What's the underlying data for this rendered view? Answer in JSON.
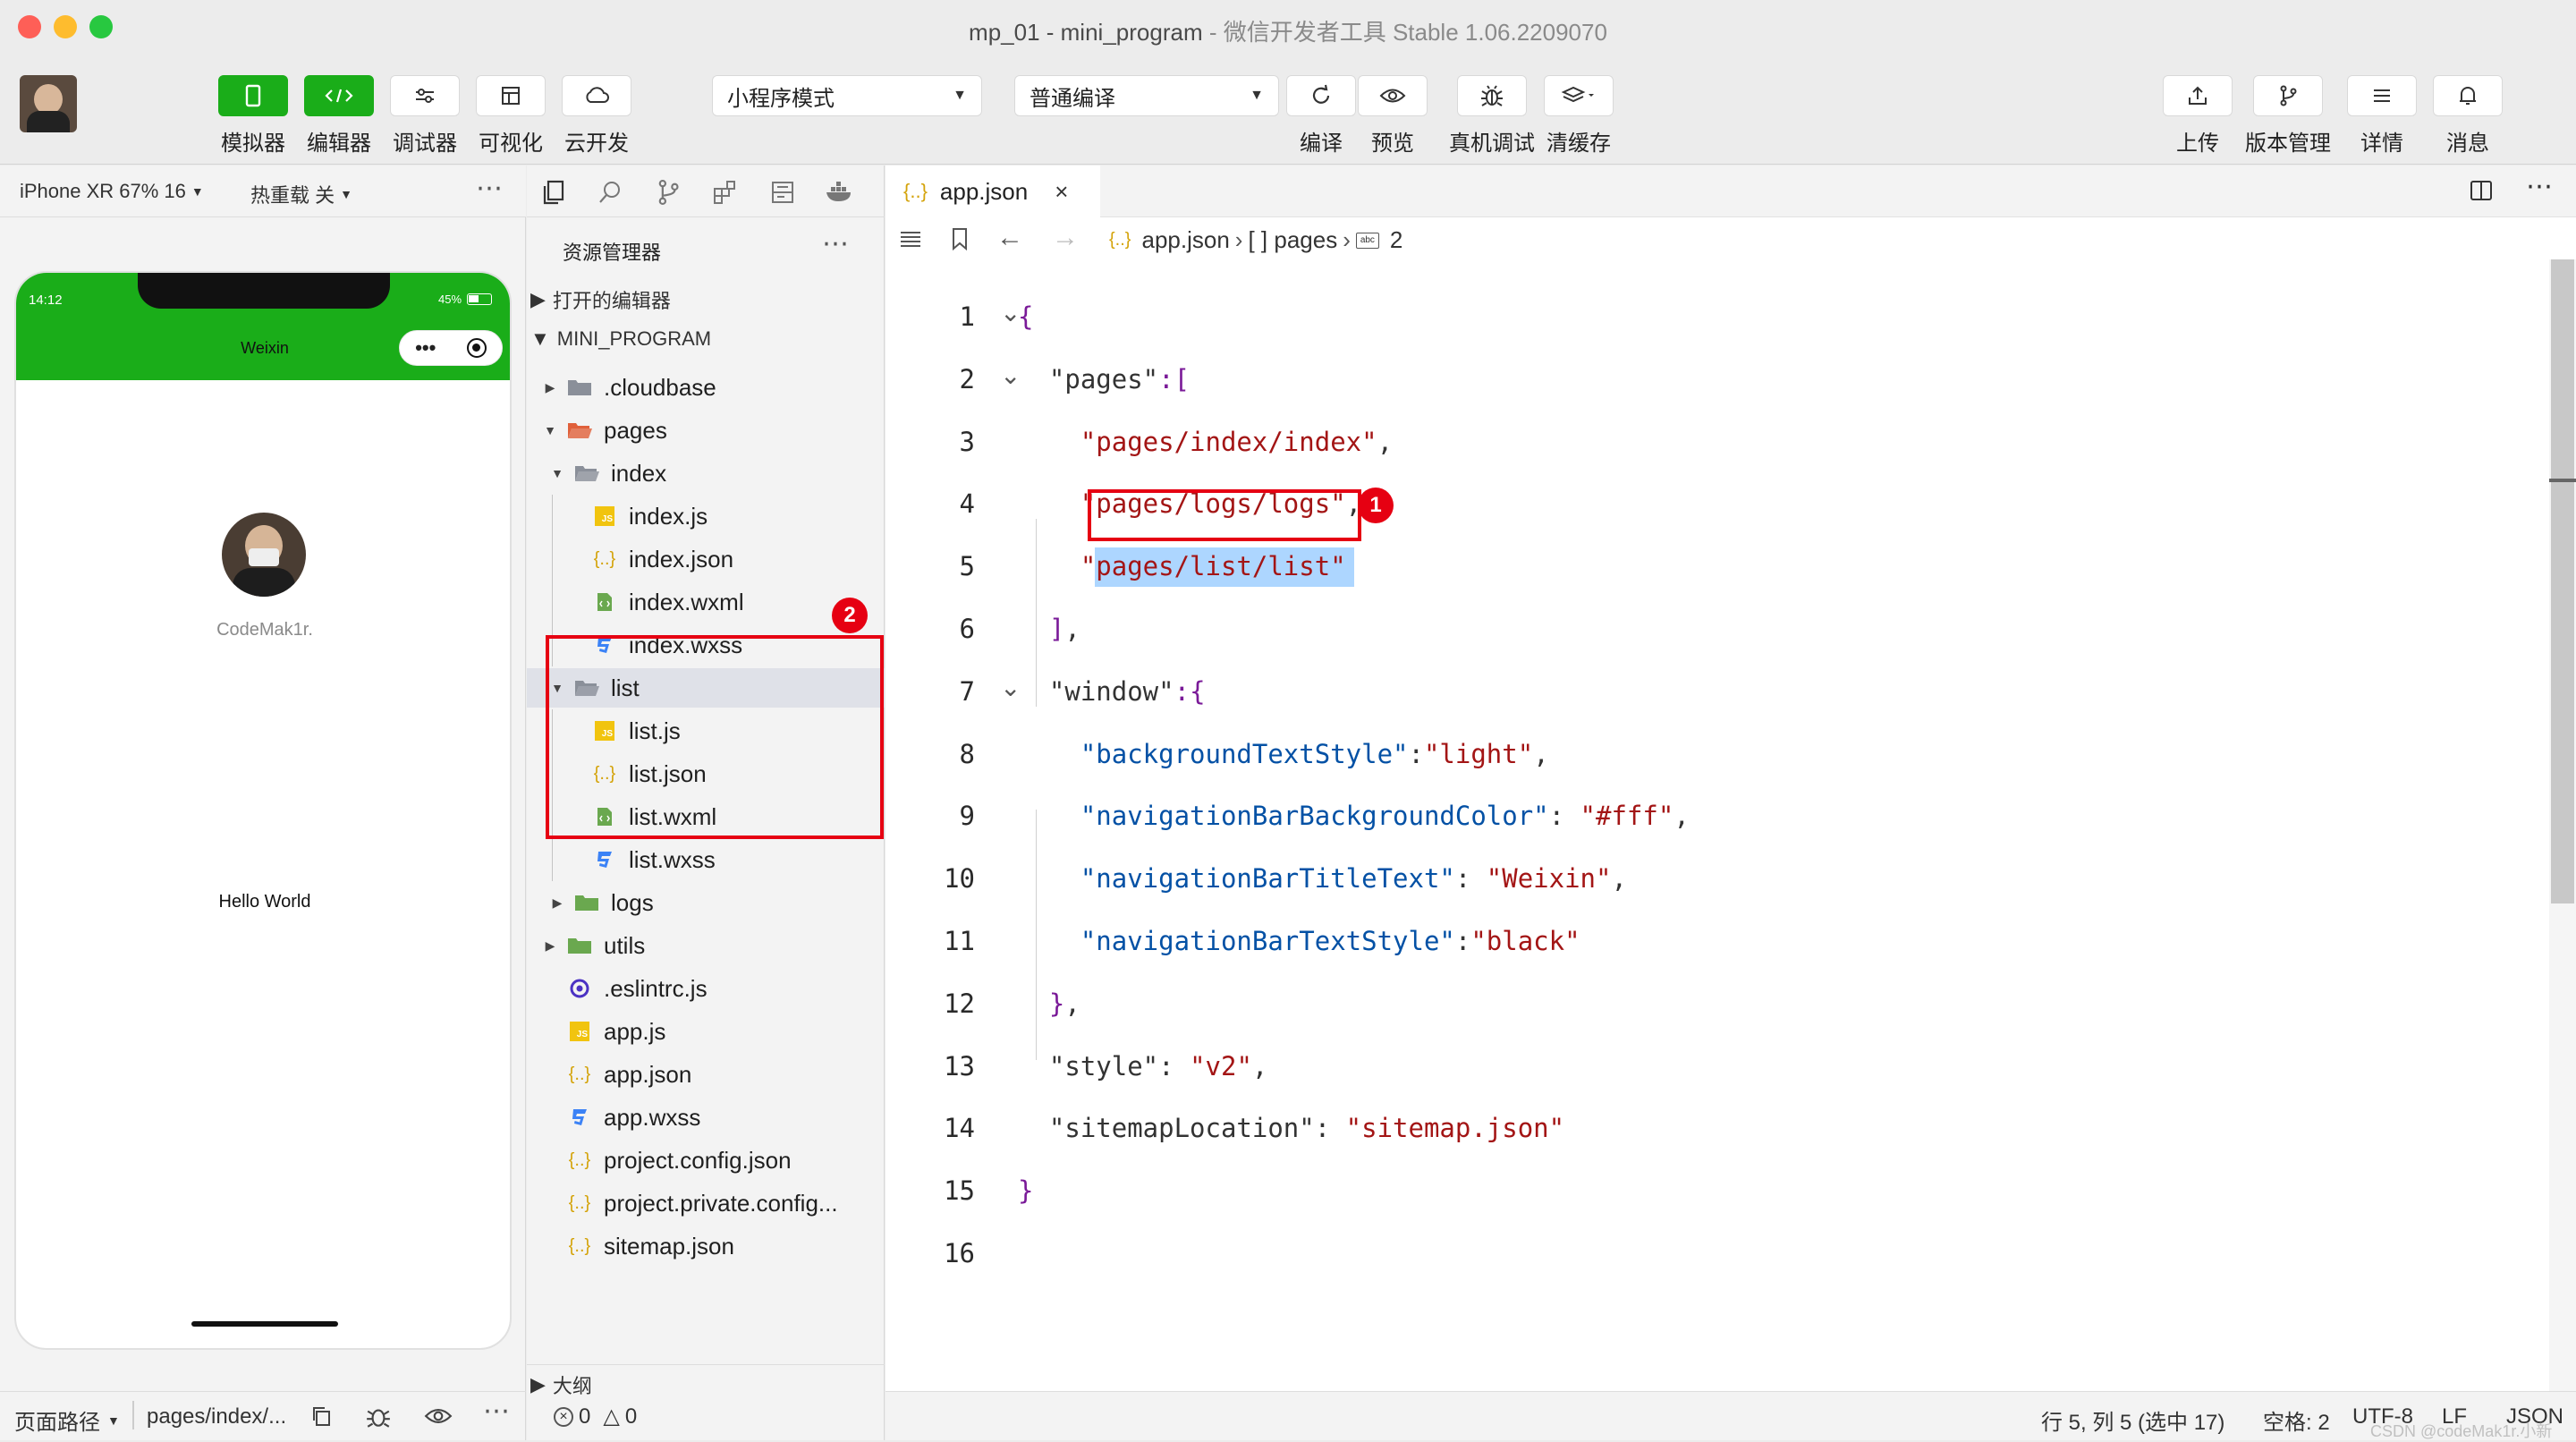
{
  "window": {
    "title_main": "mp_01 - mini_program",
    "title_sub": " - 微信开发者工具 Stable 1.06.2209070"
  },
  "toolbar": {
    "left_buttons": [
      {
        "label": "模拟器",
        "icon": "phone-icon"
      },
      {
        "label": "编辑器",
        "icon": "code-icon"
      },
      {
        "label": "调试器",
        "icon": "sliders-icon"
      },
      {
        "label": "可视化",
        "icon": "layout-icon"
      },
      {
        "label": "云开发",
        "icon": "cloud-icon"
      }
    ],
    "mode_select": "小程序模式",
    "compile_select": "普通编译",
    "mid_buttons": [
      {
        "label": "编译",
        "icon": "refresh-icon"
      },
      {
        "label": "预览",
        "icon": "eye-icon"
      },
      {
        "label": "真机调试",
        "icon": "bug-icon"
      },
      {
        "label": "清缓存",
        "icon": "layers-icon"
      }
    ],
    "right_buttons": [
      {
        "label": "上传",
        "icon": "upload-icon"
      },
      {
        "label": "版本管理",
        "icon": "branch-icon"
      },
      {
        "label": "详情",
        "icon": "menu-icon"
      },
      {
        "label": "消息",
        "icon": "bell-icon"
      }
    ]
  },
  "simulator": {
    "device": "iPhone XR 67% 16",
    "hot_reload": "热重载 关",
    "status_time": "14:12",
    "battery": "45%",
    "nav_title": "Weixin",
    "username": "CodeMak1r.",
    "hello": "Hello World",
    "footer_path_label": "页面路径",
    "footer_path": "pages/index/..."
  },
  "explorer": {
    "title": "资源管理器",
    "open_editors": "打开的编辑器",
    "project": "MINI_PROGRAM",
    "outline": "大纲",
    "items": [
      {
        "name": ".cloudbase",
        "type": "folder",
        "depth": 1,
        "expanded": false
      },
      {
        "name": "pages",
        "type": "folder-red",
        "depth": 1,
        "expanded": true
      },
      {
        "name": "index",
        "type": "folder-open",
        "depth": 2,
        "expanded": true
      },
      {
        "name": "index.js",
        "type": "js",
        "depth": 3
      },
      {
        "name": "index.json",
        "type": "json",
        "depth": 3
      },
      {
        "name": "index.wxml",
        "type": "wxml",
        "depth": 3
      },
      {
        "name": "index.wxss",
        "type": "wxss",
        "depth": 3
      },
      {
        "name": "list",
        "type": "folder-open",
        "depth": 2,
        "expanded": true,
        "selected": true
      },
      {
        "name": "list.js",
        "type": "js",
        "depth": 3
      },
      {
        "name": "list.json",
        "type": "json",
        "depth": 3
      },
      {
        "name": "list.wxml",
        "type": "wxml",
        "depth": 3
      },
      {
        "name": "list.wxss",
        "type": "wxss",
        "depth": 3
      },
      {
        "name": "logs",
        "type": "folder-green",
        "depth": 2,
        "expanded": false
      },
      {
        "name": "utils",
        "type": "folder-green",
        "depth": 1,
        "expanded": false
      },
      {
        "name": ".eslintrc.js",
        "type": "eslint",
        "depth": 1
      },
      {
        "name": "app.js",
        "type": "js",
        "depth": 1
      },
      {
        "name": "app.json",
        "type": "json",
        "depth": 1
      },
      {
        "name": "app.wxss",
        "type": "wxss",
        "depth": 1
      },
      {
        "name": "project.config.json",
        "type": "json",
        "depth": 1
      },
      {
        "name": "project.private.config...",
        "type": "json",
        "depth": 1
      },
      {
        "name": "sitemap.json",
        "type": "json",
        "depth": 1
      }
    ]
  },
  "editor": {
    "tab": "app.json",
    "breadcrumb": [
      "app.json",
      "[ ] pages",
      "2"
    ],
    "lines": [
      [
        {
          "t": "{",
          "c": "p"
        }
      ],
      [
        {
          "t": "  \"pages\"",
          "c": "k"
        },
        {
          "t": ":[",
          "c": "p"
        }
      ],
      [
        {
          "t": "    \"pages/index/index\"",
          "c": "s"
        },
        {
          "t": ",",
          "c": "o"
        }
      ],
      [
        {
          "t": "    \"pages/logs/logs\"",
          "c": "s"
        },
        {
          "t": ",",
          "c": "o"
        }
      ],
      [
        {
          "t": "    \"pages/list/list\"",
          "c": "s"
        }
      ],
      [
        {
          "t": "  ]",
          "c": "p"
        },
        {
          "t": ",",
          "c": "o"
        }
      ],
      [
        {
          "t": "  \"window\"",
          "c": "k"
        },
        {
          "t": ":{",
          "c": "p"
        }
      ],
      [
        {
          "t": "    \"backgroundTextStyle\"",
          "c": "key"
        },
        {
          "t": ":",
          "c": "o"
        },
        {
          "t": "\"light\"",
          "c": "val"
        },
        {
          "t": ",",
          "c": "o"
        }
      ],
      [
        {
          "t": "    \"navigationBarBackgroundColor\"",
          "c": "key"
        },
        {
          "t": ": ",
          "c": "o"
        },
        {
          "t": "\"#fff\"",
          "c": "val"
        },
        {
          "t": ",",
          "c": "o"
        }
      ],
      [
        {
          "t": "    \"navigationBarTitleText\"",
          "c": "key"
        },
        {
          "t": ": ",
          "c": "o"
        },
        {
          "t": "\"Weixin\"",
          "c": "val"
        },
        {
          "t": ",",
          "c": "o"
        }
      ],
      [
        {
          "t": "    \"navigationBarTextStyle\"",
          "c": "key"
        },
        {
          "t": ":",
          "c": "o"
        },
        {
          "t": "\"black\"",
          "c": "val"
        }
      ],
      [
        {
          "t": "  }",
          "c": "p"
        },
        {
          "t": ",",
          "c": "o"
        }
      ],
      [
        {
          "t": "  \"style\"",
          "c": "k"
        },
        {
          "t": ": ",
          "c": "o"
        },
        {
          "t": "\"v2\"",
          "c": "val"
        },
        {
          "t": ",",
          "c": "o"
        }
      ],
      [
        {
          "t": "  \"sitemapLocation\"",
          "c": "k"
        },
        {
          "t": ": ",
          "c": "o"
        },
        {
          "t": "\"sitemap.json\"",
          "c": "val"
        }
      ],
      [
        {
          "t": "}",
          "c": "p"
        }
      ],
      []
    ],
    "line_numbers": [
      "1",
      "2",
      "3",
      "4",
      "5",
      "6",
      "7",
      "8",
      "9",
      "10",
      "11",
      "12",
      "13",
      "14",
      "15",
      "16"
    ]
  },
  "status": {
    "errors": "0",
    "warnings": "0",
    "position": "行 5, 列 5 (选中 17)",
    "indent": "空格: 2",
    "encoding": "UTF-8",
    "eol": "LF",
    "language": "JSON",
    "watermark": "CSDN @codeMak1r.小新"
  },
  "annotations": {
    "badge1": "1",
    "badge2": "2"
  },
  "colors": {
    "accent_green": "#1aad19",
    "highlight_red": "#e60012",
    "selection": "#add6ff"
  }
}
